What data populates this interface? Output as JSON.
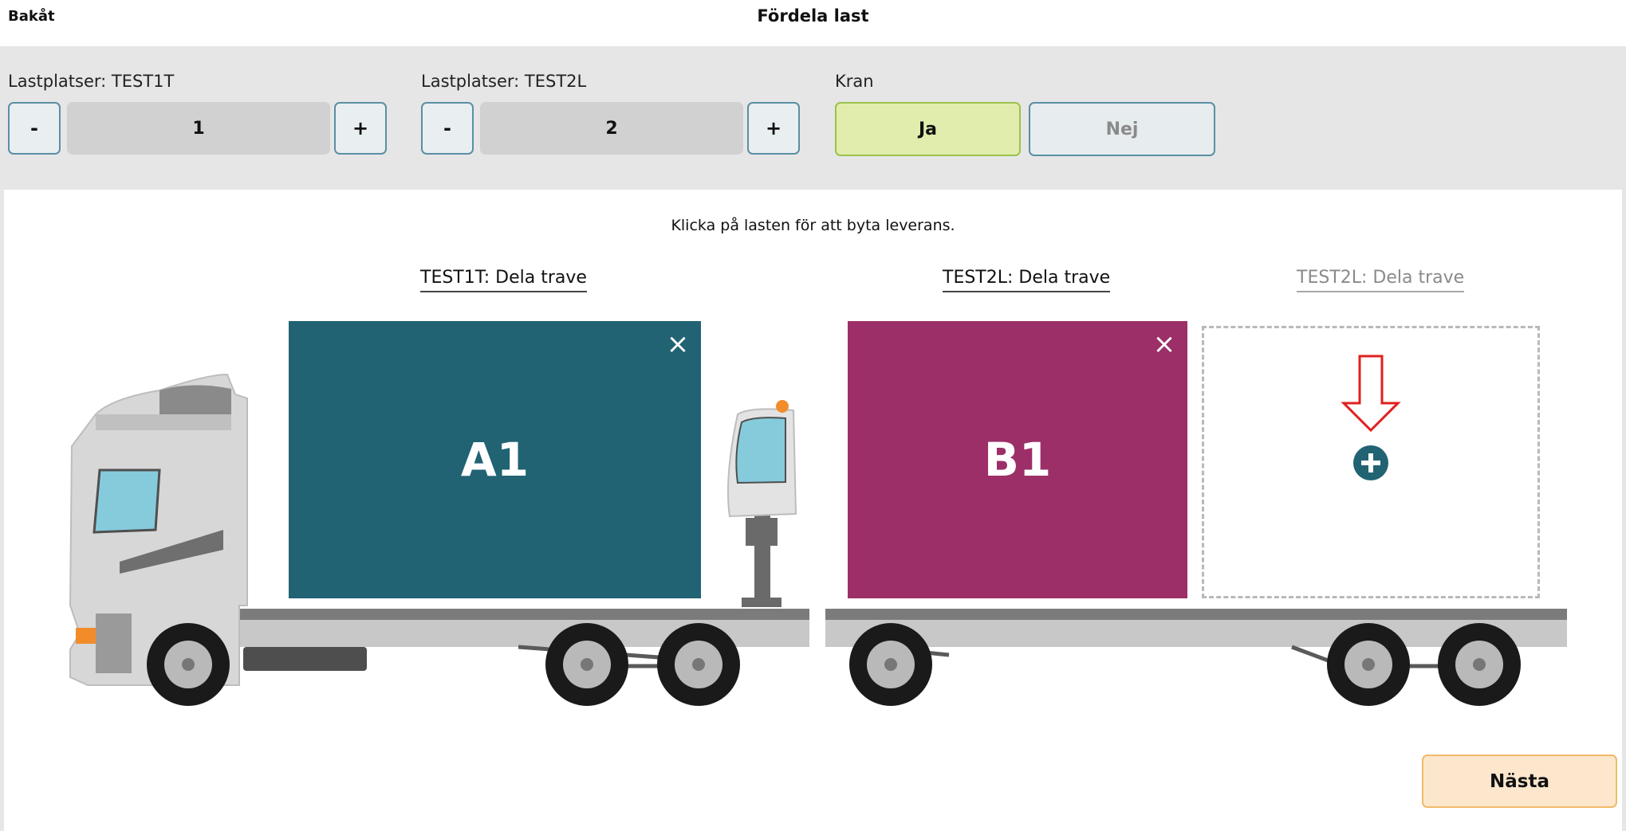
{
  "header": {
    "back_label": "Bakåt",
    "title": "Fördela last"
  },
  "controls": {
    "stop1": {
      "label": "Lastplatser: TEST1T",
      "minus": "-",
      "value": "1",
      "plus": "+"
    },
    "stop2": {
      "label": "Lastplatser: TEST2L",
      "minus": "-",
      "value": "2",
      "plus": "+"
    },
    "crane": {
      "label": "Kran",
      "yes": "Ja",
      "no": "Nej",
      "selected": "Ja"
    }
  },
  "instruction": "Klicka på lasten för att byta leverans.",
  "slots": [
    {
      "label": "TEST1T: Dela trave",
      "load": "A1",
      "color": "#216373"
    },
    {
      "label": "TEST2L: Dela trave",
      "load": "B1",
      "color": "#9c2f68"
    },
    {
      "label": "TEST2L: Dela trave",
      "load": "",
      "empty": true
    }
  ],
  "icons": {
    "remove": "close-icon",
    "add": "plus-circle-icon",
    "hint": "arrow-down-icon"
  },
  "colors": {
    "accent": "#216373",
    "magenta": "#9c2f68",
    "yes_bg": "#e1edac",
    "next_bg": "#fce7cd"
  },
  "footer": {
    "next_label": "Nästa"
  }
}
